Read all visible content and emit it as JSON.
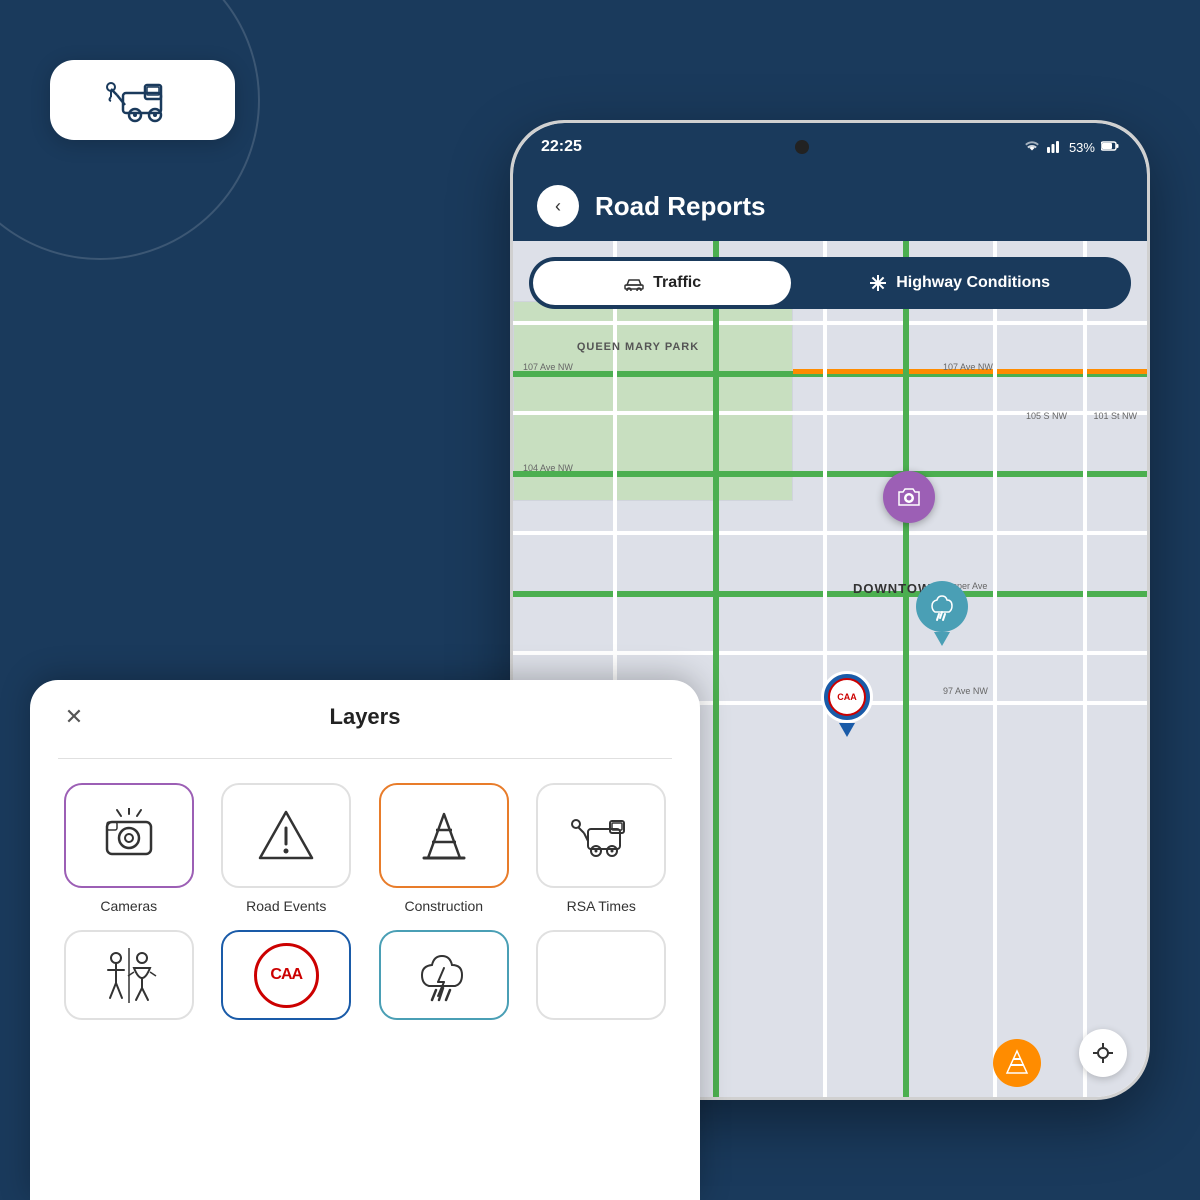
{
  "background": {
    "color": "#1a3a5c"
  },
  "tow_badge": {
    "icon": "🚛"
  },
  "status_bar": {
    "time": "22:25",
    "battery": "53%",
    "signal": "WiFi + bars"
  },
  "header": {
    "title": "Road Reports",
    "back_label": "‹"
  },
  "tabs": {
    "traffic": {
      "label": "Traffic",
      "icon": "🚗"
    },
    "highway": {
      "label": "Highway Conditions",
      "icon": "❄"
    }
  },
  "map": {
    "labels": {
      "queen_mary": "QUEEN MARY PARK",
      "downtown": "DOWNTOWN",
      "streets": [
        "107 Ave NW",
        "107 Ave NW",
        "104 Ave NW",
        "97 Ave NW",
        "Jasper Ave",
        "101 St NW",
        "105 St NW"
      ]
    }
  },
  "layers_panel": {
    "title": "Layers",
    "close_label": "✕",
    "row1": [
      {
        "label": "Cameras",
        "icon_type": "camera",
        "active": "purple"
      },
      {
        "label": "Road Events",
        "icon_type": "warning",
        "active": "none"
      },
      {
        "label": "Construction",
        "icon_type": "cone",
        "active": "orange"
      },
      {
        "label": "RSA Times",
        "icon_type": "tow",
        "active": "none"
      }
    ],
    "row2": [
      {
        "label": "Restrooms",
        "icon_type": "restroom",
        "active": "none"
      },
      {
        "label": "CAA",
        "icon_type": "caa",
        "active": "blue"
      },
      {
        "label": "Weather",
        "icon_type": "storm",
        "active": "teal"
      },
      {
        "label": "",
        "icon_type": "empty",
        "active": "none"
      }
    ]
  }
}
